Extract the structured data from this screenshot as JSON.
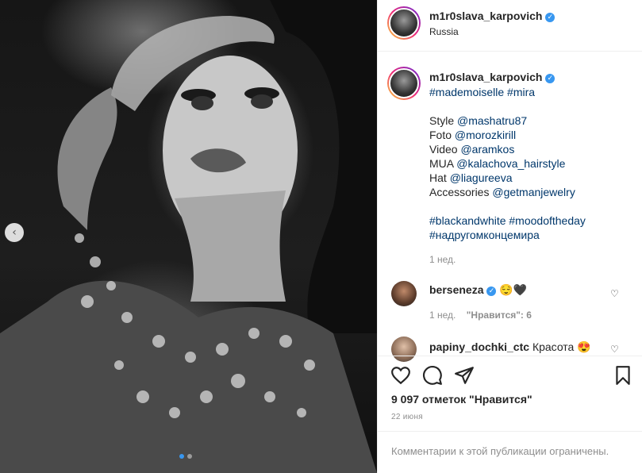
{
  "post": {
    "username": "m1r0slava_karpovich",
    "location": "Russia",
    "caption": {
      "hashtags_top": "#mademoiselle #mira",
      "credits": [
        {
          "label": "Style",
          "handle": "@mashatru87"
        },
        {
          "label": "Foto",
          "handle": "@morozkirill"
        },
        {
          "label": "Video",
          "handle": "@aramkos"
        },
        {
          "label": "MUA",
          "handle": "@kalachova_hairstyle"
        },
        {
          "label": "Hat",
          "handle": "@liagureeva"
        },
        {
          "label": "Accessories",
          "handle": "@getmanjewelry"
        }
      ],
      "hashtags_bottom_1": "#blackandwhite #moodoftheday",
      "hashtags_bottom_2": "#надругомконцемира",
      "age": "1 нед."
    },
    "comments": [
      {
        "username": "berseneza",
        "text": "😌🖤",
        "age": "1 нед.",
        "likes": "\"Нравится\": 6"
      },
      {
        "username": "papiny_dochki_ctc",
        "text": "Красота 😍"
      }
    ],
    "likes_text": "9 097 отметок \"Нравится\"",
    "date": "22 июня",
    "comments_disabled": "Комментарии к этой публикации ограничены."
  },
  "carousel": {
    "prev_icon": "chevron-left-icon",
    "dots": 2,
    "active_dot": 0
  },
  "colors": {
    "verified": "#3897f0",
    "link": "#00376b",
    "muted": "#8e8e8e"
  }
}
